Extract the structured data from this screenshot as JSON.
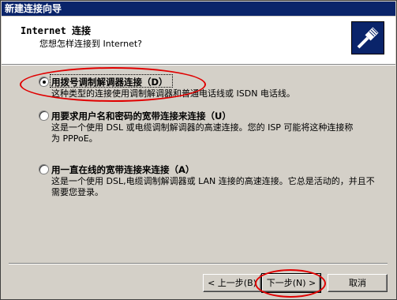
{
  "window": {
    "title": "新建连接向导"
  },
  "header": {
    "title": "Internet 连接",
    "subtitle": "您想怎样连接到 Internet?",
    "icon": "network-cable-icon"
  },
  "options": [
    {
      "label": "用拨号调制解调器连接（D）",
      "description": "这种类型的连接使用调制解调器和普通电话线或 ISDN 电话线。",
      "selected": true
    },
    {
      "label": "用要求用户名和密码的宽带连接来连接（U）",
      "description": "这是一个使用 DSL 或电缆调制解调器的高速连接。您的 ISP 可能将这种连接称为 PPPoE。",
      "selected": false
    },
    {
      "label": "用一直在线的宽带连接来连接（A）",
      "description": "这是一个使用 DSL,电缆调制解调器或 LAN 连接的高速连接。它总是活动的，并且不需要您登录。",
      "selected": false
    }
  ],
  "buttons": {
    "back": "< 上一步(B)",
    "next": "下一步(N) >",
    "cancel": "取消"
  },
  "annotation_color": "#e00000"
}
